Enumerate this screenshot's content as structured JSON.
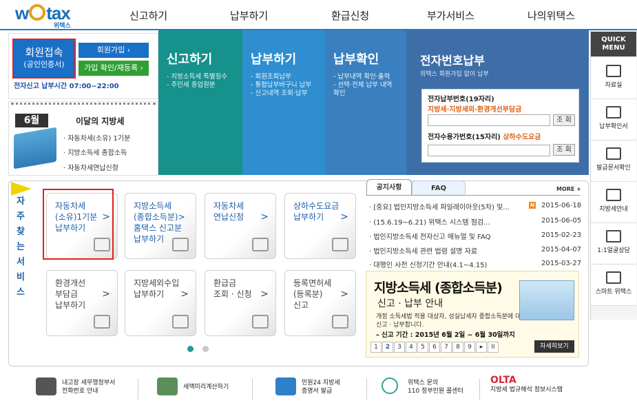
{
  "brand": {
    "logo": "wetax",
    "sub": "위택스"
  },
  "gnb": [
    "신고하기",
    "납부하기",
    "환급신청",
    "부가서비스",
    "나의위택스"
  ],
  "login": {
    "btn": "회원접속",
    "btn_sub": "(공인인증서)",
    "join": "회원가입",
    "check": "가입 확인/재등록",
    "time": "전자신고 납부시간 07:00~22:00"
  },
  "monthly": {
    "month": "6월",
    "title": "이달의 지방세",
    "items": [
      "· 자동차세(소유) 1기분",
      "· 지방소득세 종합소득",
      "· 자동차세연납신청"
    ]
  },
  "banners": {
    "report": {
      "title": "신고하기",
      "items": [
        "- 지방소득세 특별징수",
        "- 주민세 종업원분"
      ]
    },
    "pay": {
      "title": "납부하기",
      "items": [
        "- 회원조회납부",
        "- 통합납부바구니 납부",
        "- 신고내역 조회·납부"
      ]
    },
    "check": {
      "title": "납부확인",
      "items": [
        "- 납부내역 확인·출력",
        "- 선택·전체 납부 내역",
        "  확인"
      ]
    },
    "epay": {
      "title": "전자번호납부",
      "sub": "위택스 회원가입 없이 납부",
      "l1": "전자납부번호(19자리)",
      "l1b": "지방세·지방세외·환경개선부담금",
      "l2": "전자수용가번호(15자리)",
      "l2b": "상하수도요금",
      "btn": "조 회"
    }
  },
  "quick": {
    "head": "QUICK MENU",
    "items": [
      "자료실",
      "납부확인서",
      "발급문서확인",
      "지방세안내",
      "1:1얼굴상담",
      "스마트 위택스"
    ]
  },
  "fav": {
    "side": "자주찾는서비스",
    "tiles": [
      {
        "l1": "자동차세",
        "l2": "(소유)1기분",
        "l3": "납부하기"
      },
      {
        "l1": "지방소득세",
        "l2": "(종합소득분)>",
        "l3": "홈택스 신고분",
        "l4": "납부하기"
      },
      {
        "l1": "자동차세",
        "l2": "연납신청",
        "l3": ""
      },
      {
        "l1": "상하수도요금",
        "l2": "납부하기",
        "l3": ""
      },
      {
        "l1": "환경개선",
        "l2": "부담금",
        "l3": "납부하기"
      },
      {
        "l1": "지방세외수입",
        "l2": "납부하기",
        "l3": ""
      },
      {
        "l1": "환급금",
        "l2": "조회 · 신청",
        "l3": ""
      },
      {
        "l1": "등록면허세",
        "l2": "(등록분)",
        "l3": "신고"
      }
    ]
  },
  "notice": {
    "tab1": "공지사항",
    "tab2": "FAQ",
    "more": "MORE +",
    "items": [
      {
        "t": "· [중요] 법인지방소득세 파일레이아웃(5차) 및...",
        "d": "2015-06-18"
      },
      {
        "t": "· (15.6.19~6.21) 위택스 시스템 점검...",
        "d": "2015-06-05"
      },
      {
        "t": "· 법인지방소득세 전자신고 메뉴얼 및 FAQ",
        "d": "2015-02-23"
      },
      {
        "t": "· 법인지방소득세 관련 법령 설명 자료",
        "d": "2015-04-07"
      },
      {
        "t": "· 대행인 사전 신청기간 안내(4.1~4.15)",
        "d": "2015-03-27"
      }
    ],
    "new": "N"
  },
  "promo": {
    "title": "지방소득세 (종합소득분)",
    "sub": "신고 · 납부 안내",
    "d1": "개정 소득세법 적용 대상자, 성실납세자 종합소득분에 대해",
    "d2": "신고 · 납부합니다.",
    "d3": "– 신고 기간 : 2015년 6월 2일 ~ 6월 30일까지",
    "detail": "자세히보기",
    "pages": [
      "1",
      "2",
      "3",
      "4",
      "5",
      "6",
      "7",
      "8",
      "9",
      "▸",
      "II"
    ]
  },
  "footer": [
    {
      "a": "내고장 세무행정부서",
      "b": "전화번호 안내"
    },
    {
      "a": "세액미리계산하기",
      "b": ""
    },
    {
      "a": "민원24 지방세",
      "b": "증명서 발급"
    },
    {
      "a": "위택스 문의",
      "b": "110 정부민원 콜센터"
    },
    {
      "a": "OLTA",
      "b": "지방세 법규해석 정보시스템"
    }
  ]
}
